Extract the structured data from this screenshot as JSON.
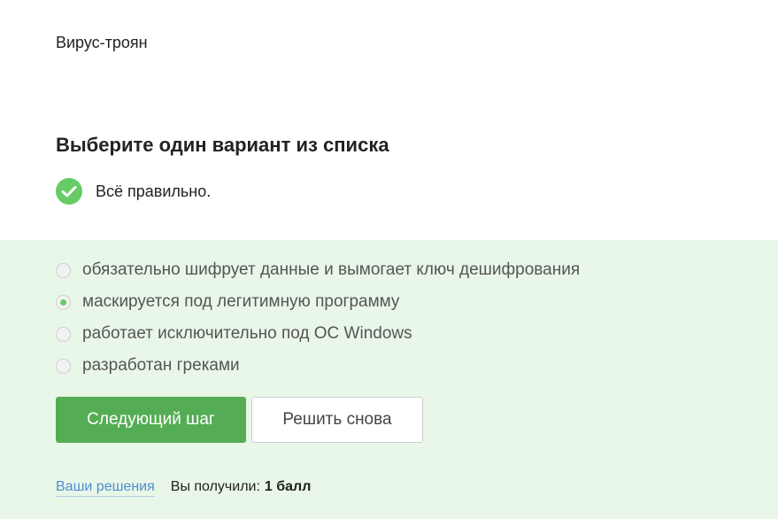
{
  "question": {
    "text": "Вирус-троян"
  },
  "quiz": {
    "heading": "Выберите один вариант из списка",
    "result_icon": "check-circle-icon",
    "result_text": "Всё правильно.",
    "accent_color": "#54ad54",
    "panel_color": "#e9f7e9",
    "options": [
      {
        "label": "обязательно шифрует данные и вымогает ключ дешифрования",
        "selected": false
      },
      {
        "label": "маскируется под легитимную программу",
        "selected": true
      },
      {
        "label": "работает исключительно под ОС Windows",
        "selected": false
      },
      {
        "label": "разработан греками",
        "selected": false
      }
    ]
  },
  "actions": {
    "next_label": "Следующий шаг",
    "retry_label": "Решить снова"
  },
  "footer": {
    "solutions_link": "Ваши решения",
    "score_label": "Вы получили:",
    "score_value": "1 балл"
  }
}
